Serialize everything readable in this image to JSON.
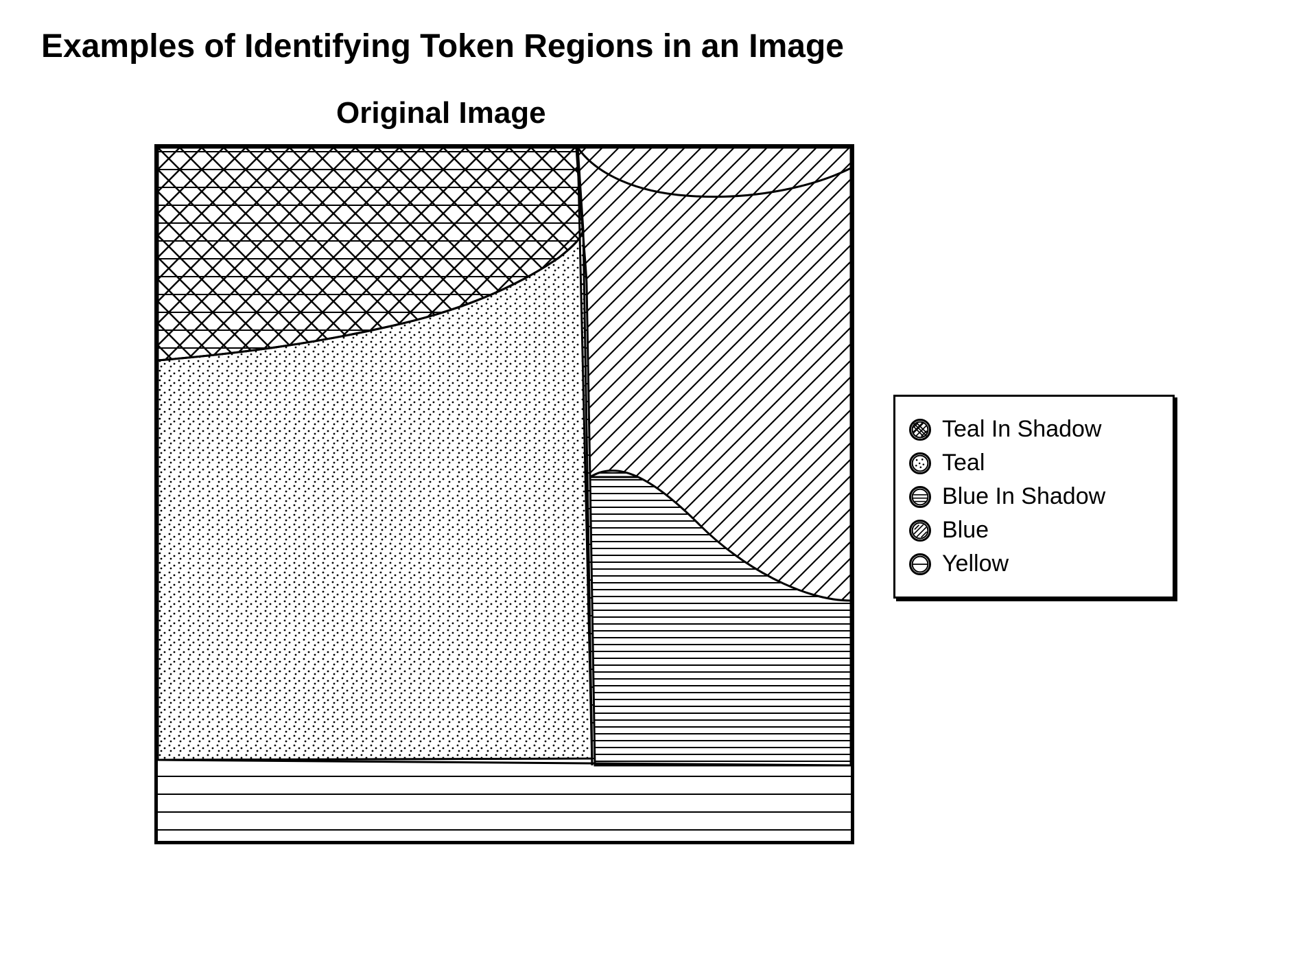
{
  "title": "Examples of Identifying Token Regions in an Image",
  "subtitle": "Original Image",
  "legend": {
    "items": [
      {
        "name": "teal-in-shadow",
        "label": "Teal In Shadow",
        "pattern": "crosshatch"
      },
      {
        "name": "teal",
        "label": "Teal",
        "pattern": "dots"
      },
      {
        "name": "blue-in-shadow",
        "label": "Blue In Shadow",
        "pattern": "horizontal"
      },
      {
        "name": "blue",
        "label": "Blue",
        "pattern": "diagonal"
      },
      {
        "name": "yellow",
        "label": "Yellow",
        "pattern": "horiz-sparse"
      }
    ]
  },
  "regions": {
    "teal_in_shadow": "upper-left crosshatched region",
    "teal": "large dotted region center-left",
    "blue": "diagonal-lined region upper-right",
    "blue_in_shadow": "horizontal-lined region right-middle",
    "yellow": "horizontal-lined band at bottom and lower portion"
  }
}
